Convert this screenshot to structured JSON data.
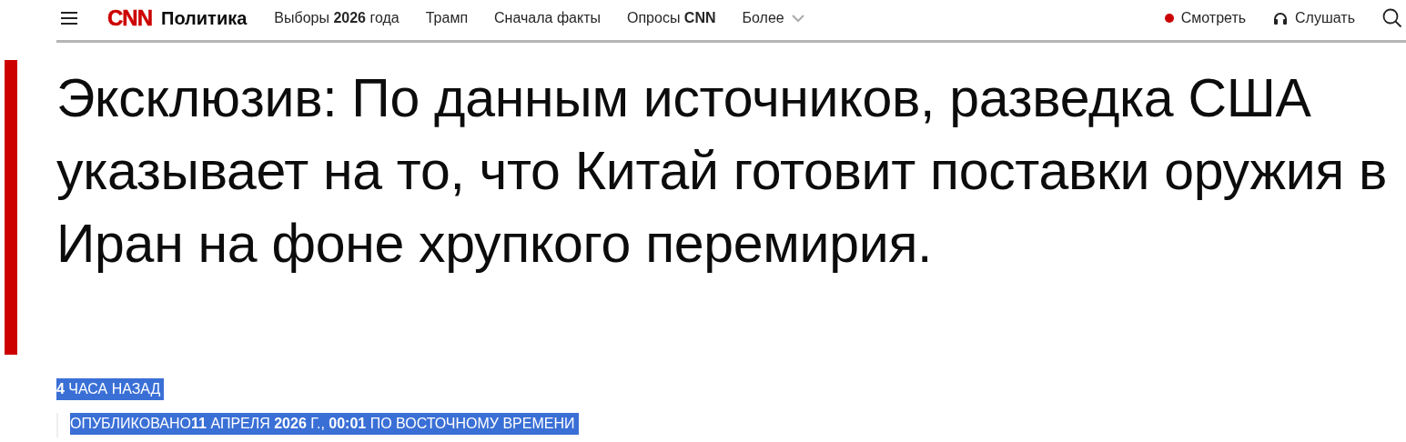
{
  "header": {
    "logo": "CNN",
    "section": "Политика",
    "nav": [
      {
        "label": "Выборы **2026** года"
      },
      {
        "label": "Трамп"
      },
      {
        "label": "Сначала факты"
      },
      {
        "label": "Опросы **CNN**"
      },
      {
        "label": "Более",
        "kind": "dropdown"
      }
    ],
    "actions": [
      {
        "label": "Смотреть",
        "kind": "watch"
      },
      {
        "label": "Слушать",
        "kind": "listen"
      }
    ]
  },
  "headline": "Эксклюзив: По данным источников, разведка США указывает на то, что Китай готовит поставки оружия в Иран на фоне хрупкого перемирия.",
  "meta": [
    {
      "text": "**4** ЧАСА НАЗАД",
      "highlighted": true
    },
    {
      "text": "ОПУБЛИКОВАНО**11** АПРЕЛЯ **2026** Г., **00:01** ПО ВОСТОЧНОМУ ВРЕМЕНИ",
      "highlighted": true
    }
  ]
}
